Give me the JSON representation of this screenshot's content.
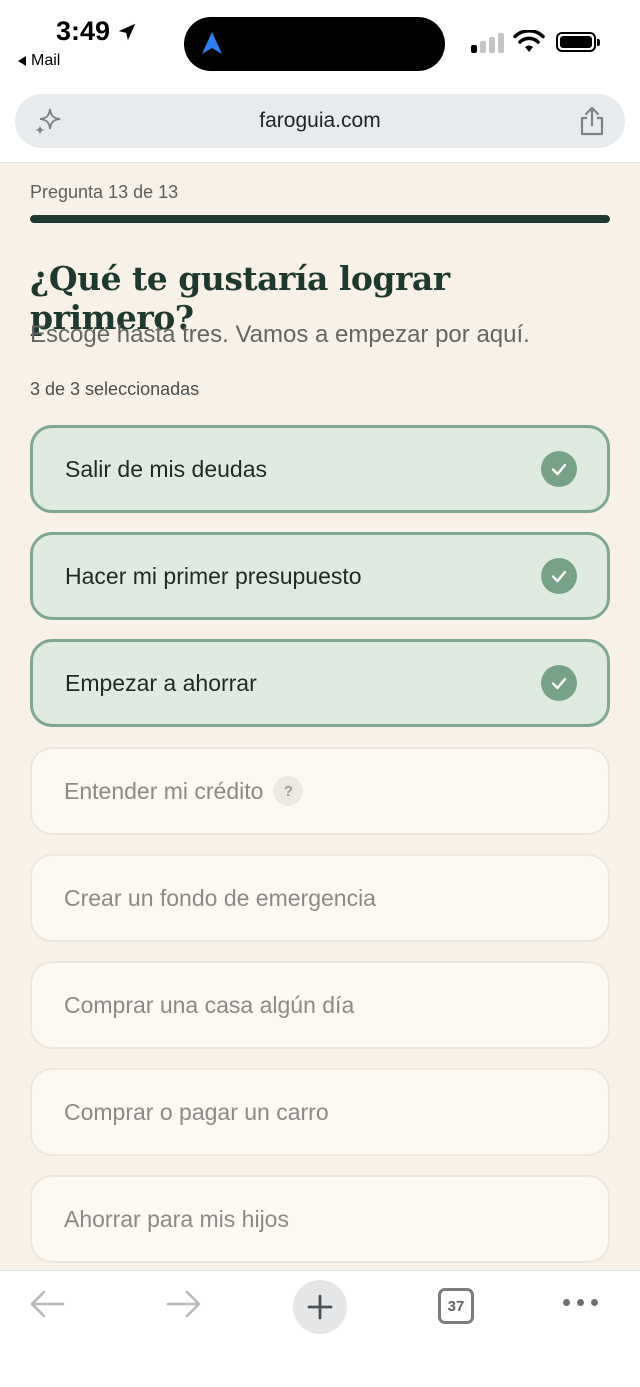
{
  "status_bar": {
    "time": "3:49",
    "back_app": "Mail"
  },
  "browser": {
    "url": "faroguia.com",
    "tab_count": "37"
  },
  "quiz": {
    "progress_label": "Pregunta 13 de 13",
    "progress_fraction": 1.0,
    "question": "¿Qué te gustaría lograr primero?",
    "subtitle": "Escoge hasta tres. Vamos a empezar por aquí.",
    "selection_count": "3 de 3 seleccionadas",
    "help_glyph": "?",
    "options": [
      {
        "label": "Salir de mis deudas",
        "selected": true
      },
      {
        "label": "Hacer mi primer presupuesto",
        "selected": true
      },
      {
        "label": "Empezar a ahorrar",
        "selected": true
      },
      {
        "label": "Entender mi crédito",
        "selected": false,
        "has_help": true
      },
      {
        "label": "Crear un fondo de emergencia",
        "selected": false
      },
      {
        "label": "Comprar una casa algún día",
        "selected": false
      },
      {
        "label": "Comprar o pagar un carro",
        "selected": false
      },
      {
        "label": "Ahorrar para mis hijos",
        "selected": false
      }
    ]
  },
  "colors": {
    "background": "#f8f1e8",
    "accent_dark": "#1e3a2f",
    "selected_fill": "#dfeae1",
    "selected_border": "#7ea891",
    "check_fill": "#76a288"
  },
  "icons": {
    "status_location": "location-arrow-icon",
    "island_nav": "navigation-icon",
    "url_left": "sparkle-icon",
    "url_right": "share-icon",
    "toolbar": [
      "back-arrow-icon",
      "forward-arrow-icon",
      "plus-icon",
      "tabs-icon",
      "more-icon"
    ]
  }
}
